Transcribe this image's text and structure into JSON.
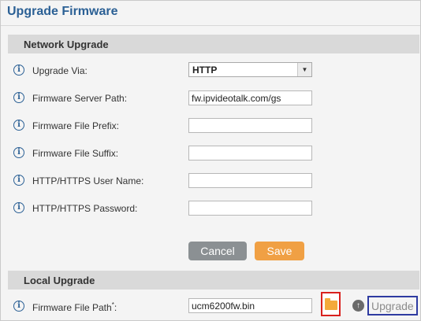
{
  "page": {
    "title": "Upgrade Firmware"
  },
  "network_upgrade": {
    "header": "Network Upgrade",
    "fields": [
      {
        "label": "Upgrade Via:",
        "value": "HTTP",
        "icon": "info-icon"
      },
      {
        "label": "Firmware Server Path:",
        "value": "fw.ipvideotalk.com/gs",
        "icon": "info-icon"
      },
      {
        "label": "Firmware File Prefix:",
        "value": "",
        "icon": "info-icon"
      },
      {
        "label": "Firmware File Suffix:",
        "value": "",
        "icon": "info-icon"
      },
      {
        "label": "HTTP/HTTPS User Name:",
        "value": "",
        "icon": "info-icon"
      },
      {
        "label": "HTTP/HTTPS Password:",
        "value": "",
        "icon": "info-icon"
      }
    ],
    "cancel_label": "Cancel",
    "save_label": "Save"
  },
  "local_upgrade": {
    "header": "Local Upgrade",
    "file_path_label": "Firmware File Path",
    "required_mark": "*",
    "file_path_colon": ":",
    "file_path_value": "ucm6200fw.bin",
    "browse_icon": "folder-icon",
    "upgrade_icon": "arrow-up-circle-icon",
    "upgrade_label": "Upgrade"
  },
  "colors": {
    "title": "#2b6095",
    "save": "#f0a044",
    "cancel": "#8b9093",
    "browse_highlight": "#d9211e",
    "upgrade_highlight": "#2e3ba1"
  }
}
